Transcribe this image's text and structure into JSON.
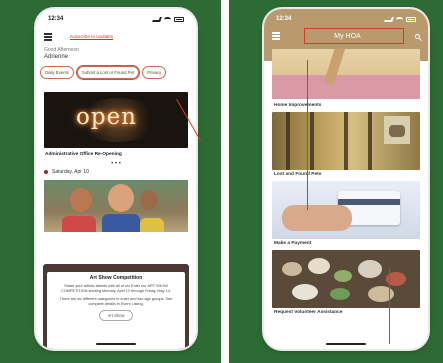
{
  "left_phone": {
    "time": "12:34",
    "subscribe_link": "Subscribe to Updates",
    "greeting": "Good Afternoon",
    "username": "Adrienne",
    "chips": [
      "Daily Events",
      "Submit a Lost or Found Pet",
      "Privacy"
    ],
    "featured_card": {
      "image_text": "open",
      "title": "Administrative Office Re-Opening"
    },
    "carousel_dots": "• • •",
    "date_label": "Saturday, Apr 10",
    "sheet": {
      "title": "Art Show Competition",
      "body1": "Share your artistic talents with all of us! Enter our ART SHOW COMPETITION starting Monday, April 12 through Friday, May 14.",
      "body2": "There are six different categories to enter and two age groups. See complete details in Event Listing.",
      "button": "Art Show"
    }
  },
  "right_phone": {
    "time": "12:34",
    "title": "My HOA",
    "items": [
      {
        "label": "Home Improvements"
      },
      {
        "label": "Lost and Found Pets"
      },
      {
        "label": "Make a Payment"
      },
      {
        "label": "Request Volunteer Assistance"
      }
    ]
  },
  "colors": {
    "background_green": "#2e6b34",
    "accent_red": "#d43a2e",
    "header_tan": "#b89a6e"
  }
}
